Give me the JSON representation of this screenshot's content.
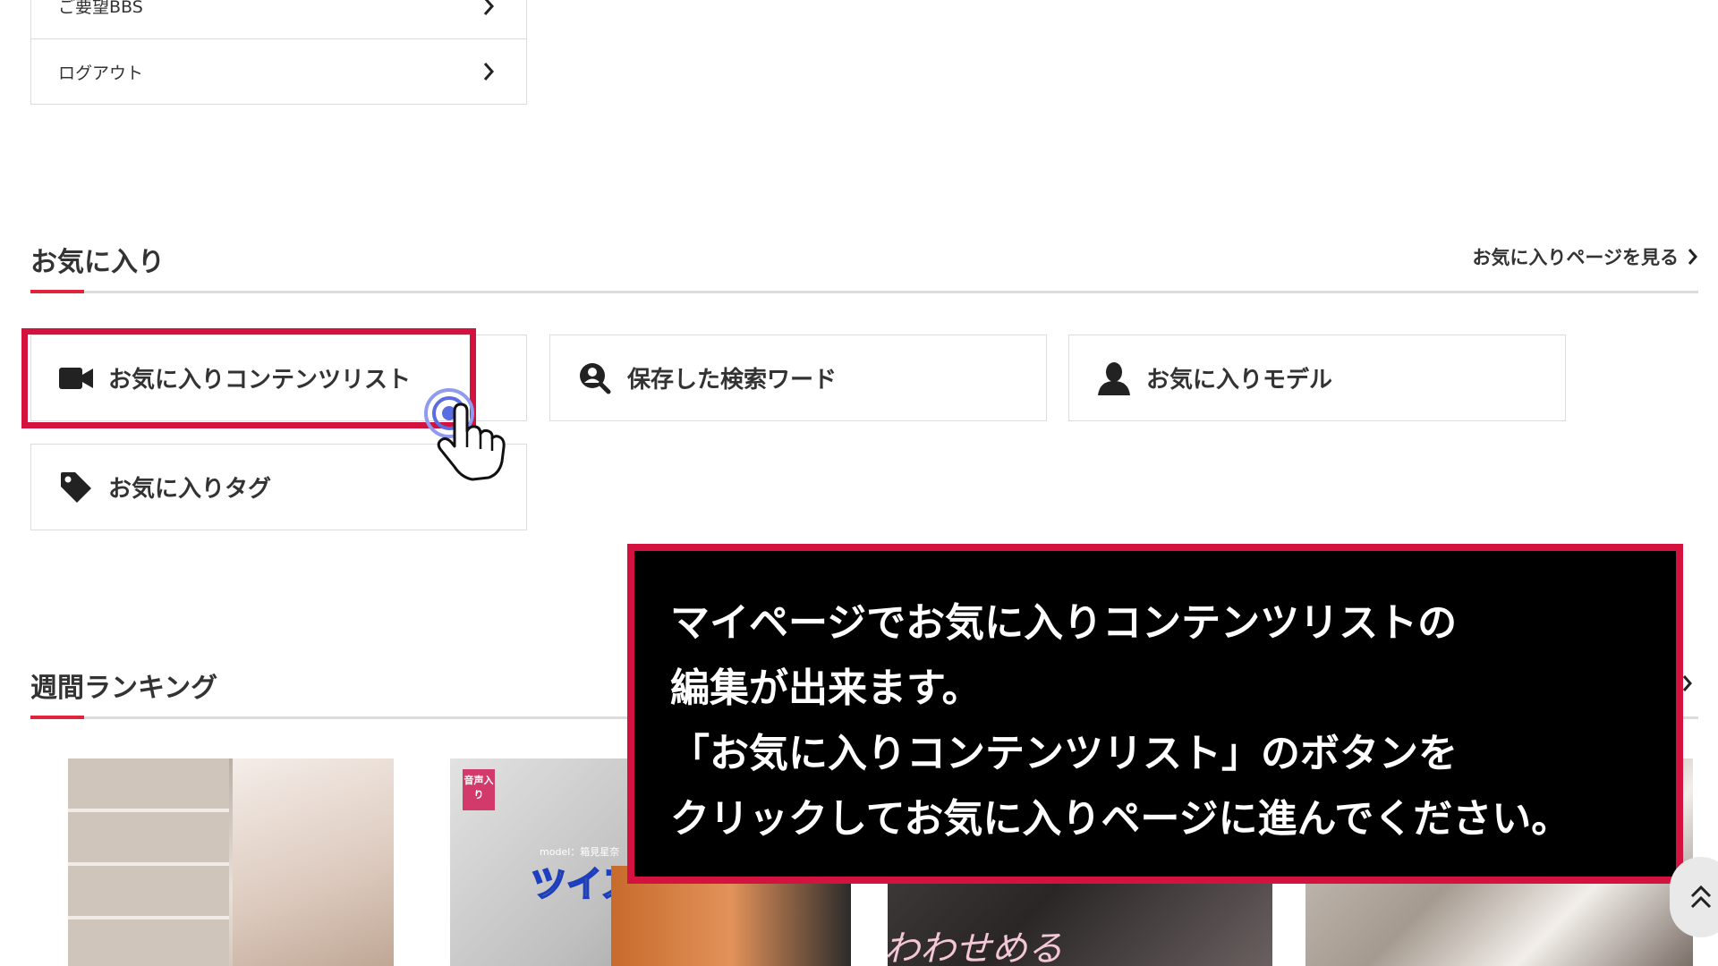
{
  "menu": {
    "items": [
      {
        "label": "ご要望BBS"
      },
      {
        "label": "ログアウト"
      }
    ]
  },
  "favorites": {
    "title": "お気に入り",
    "more_link": "お気に入りページを見る",
    "buttons": [
      {
        "label": "お気に入りコンテンツリスト",
        "icon": "video-camera-icon"
      },
      {
        "label": "保存した検索ワード",
        "icon": "search-user-icon"
      },
      {
        "label": "お気に入りモデル",
        "icon": "person-icon"
      },
      {
        "label": "お気に入りタグ",
        "icon": "tag-icon"
      }
    ]
  },
  "ranking": {
    "title": "週間ランキング",
    "thumbs": [
      {
        "badge": ""
      },
      {
        "badge": "音声入り",
        "caption": "ツイスターゲーム",
        "model": "model：箱見星奈"
      },
      {
        "caption": "わわせめる"
      },
      {
        "caption": ""
      }
    ]
  },
  "callout": {
    "lines": [
      "マイページでお気に入りコンテンツリストの",
      "編集が出来ます。",
      "「お気に入りコンテンツリスト」のボタンを",
      "クリックしてお気に入りページに進んでください。"
    ]
  },
  "colors": {
    "accent": "#e0243c",
    "highlight": "#d3123f",
    "callout_bg": "#000000",
    "border": "#dcdcdc",
    "cursor_ring": "#5b6de0"
  }
}
